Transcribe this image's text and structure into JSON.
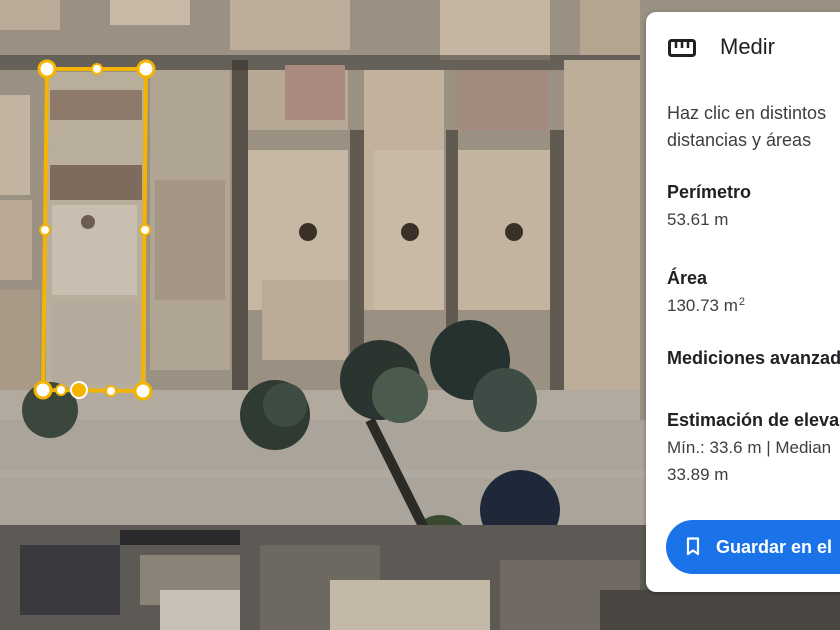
{
  "panel": {
    "title": "Medir",
    "description_line1": "Haz clic en distintos",
    "description_line2": "distancias y áreas",
    "perimeter": {
      "label": "Perímetro",
      "value": "53.61 m"
    },
    "area": {
      "label": "Área",
      "value": "130.73 m",
      "unit_sup": "2"
    },
    "advanced_label": "Mediciones avanzad",
    "elevation": {
      "label": "Estimación de eleva",
      "line1": "Mín.: 33.6 m | Median",
      "line2": "33.89 m"
    },
    "save_button_label": "Guardar en el",
    "icons": {
      "header": "ruler-icon",
      "save": "bookmark-icon"
    }
  },
  "map": {
    "measure_color": "#f4b400",
    "vertex_icon": "vertex-handle-icon",
    "midpoint_icon": "midpoint-handle-icon"
  }
}
